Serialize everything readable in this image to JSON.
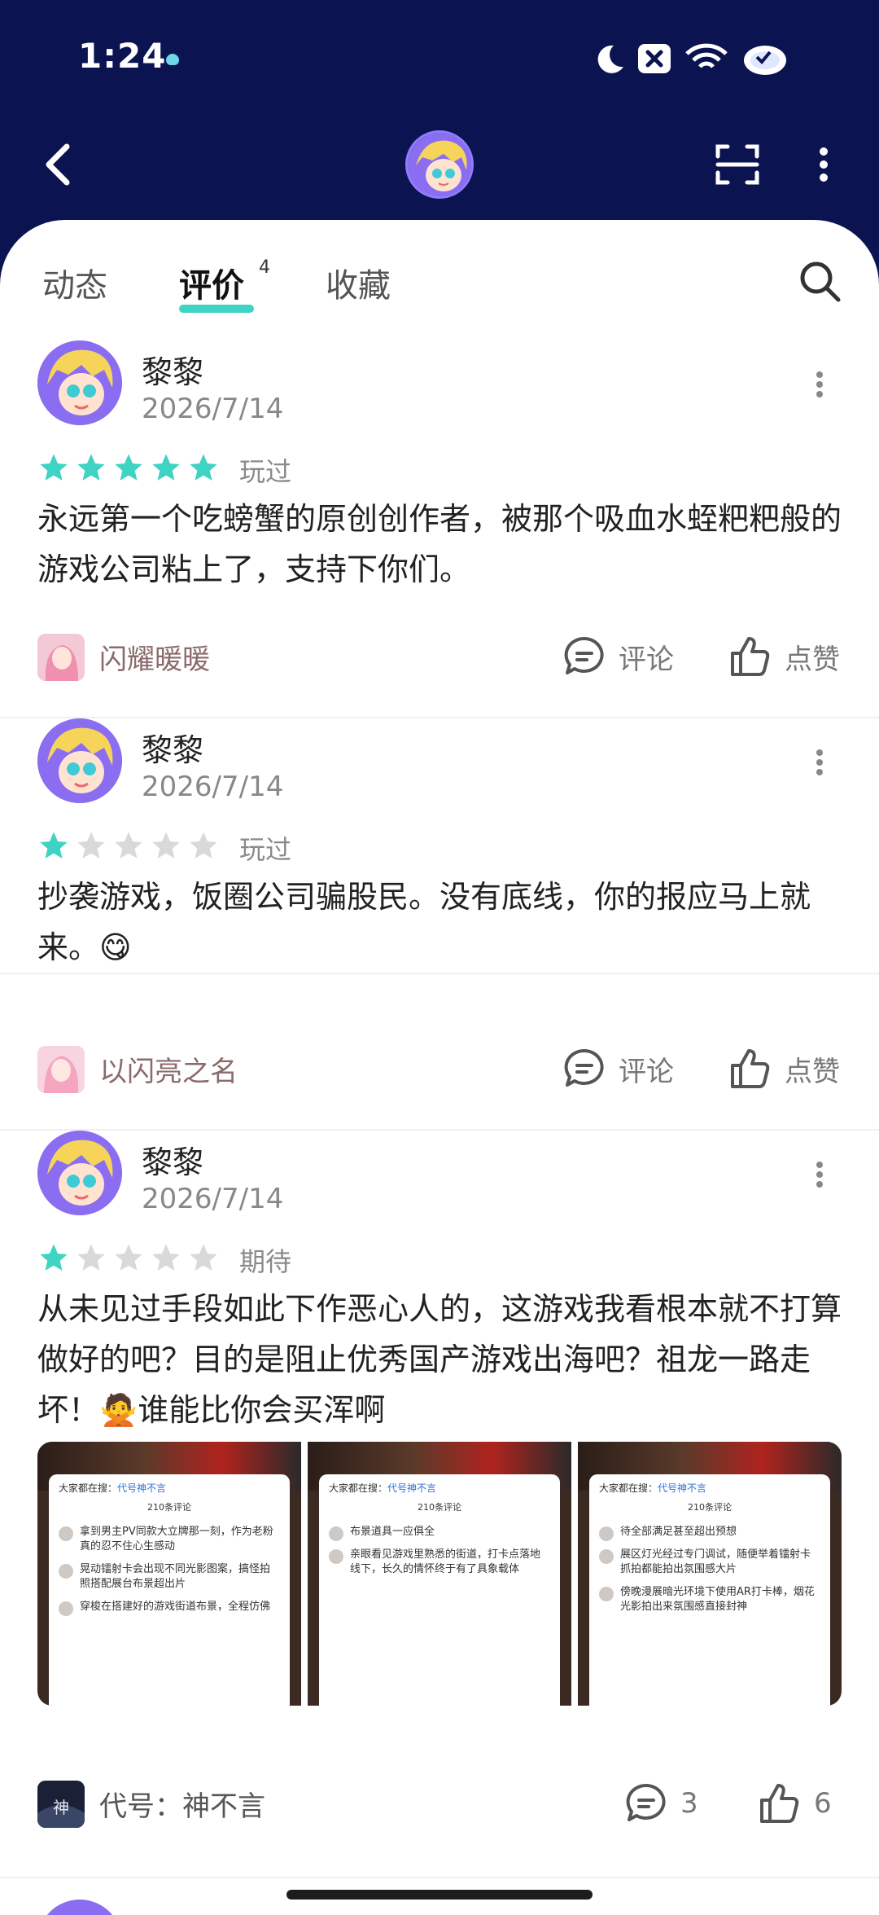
{
  "status_bar": {
    "time": "1:24"
  },
  "tabs": [
    {
      "label": "动态"
    },
    {
      "label": "评价",
      "badge": "4"
    },
    {
      "label": "收藏"
    }
  ],
  "reviews": [
    {
      "author": "黎黎",
      "date": "2026/7/14",
      "stars": 5,
      "status": "玩过",
      "text": "永远第一个吃螃蟹的原创创作者，被那个吸血水蛭粑粑般的游戏公司粘上了，支持下你们。",
      "game": "闪耀暖暖",
      "comment_label": "评论",
      "like_label": "点赞"
    },
    {
      "author": "黎黎",
      "date": "2026/7/14",
      "stars": 1,
      "status": "玩过",
      "text": "抄袭游戏，饭圈公司骗股民。没有底线，你的报应马上就来。😋",
      "game": "以闪亮之名",
      "comment_label": "评论",
      "like_label": "点赞"
    },
    {
      "author": "黎黎",
      "date": "2026/7/14",
      "stars": 1,
      "status": "期待",
      "text": "从未见过手段如此下作恶心人的，这游戏我看根本就不打算做好的吧？目的是阻止优秀国产游戏出海吧？祖龙一路走坏！🙅谁能比你会买浑啊",
      "game": "代号：神不言",
      "comment_count": "3",
      "like_count": "6",
      "thumbnails": [
        {
          "head": "大家都在搜：",
          "keyword": "代号神不言",
          "count": "210条评论",
          "items": [
            "拿到男主PV同款大立牌那一刻，作为老粉真的忍不住心生感动",
            "晃动镭射卡会出现不同光影图案，搞怪拍照搭配展台布景超出片",
            "穿梭在搭建好的游戏街道布景，全程仿佛"
          ]
        },
        {
          "head": "大家都在搜：",
          "keyword": "代号神不言",
          "count": "210条评论",
          "items": [
            "布景道具一应俱全",
            "亲眼看见游戏里熟悉的街道，打卡点落地线下，长久的情怀终于有了具象载体"
          ]
        },
        {
          "head": "大家都在搜：",
          "keyword": "代号神不言",
          "count": "210条评论",
          "items": [
            "待全部满足甚至超出预想",
            "展区灯光经过专门调试，随便举着镭射卡抓拍都能拍出氛围感大片",
            "傍晚漫展暗光环境下使用AR打卡棒，烟花光影拍出来氛围感直接封神"
          ]
        }
      ]
    }
  ],
  "colors": {
    "header_bg": "#0b1350",
    "accent": "#3ed3c2",
    "star_off": "#d9d9d9"
  }
}
